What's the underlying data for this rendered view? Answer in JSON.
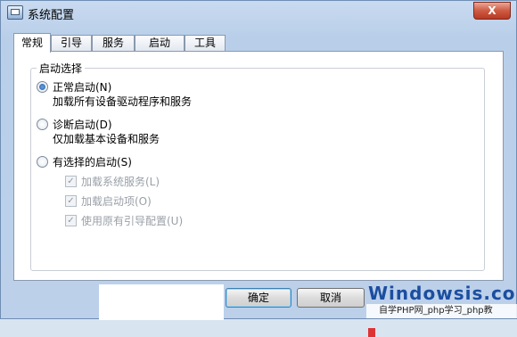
{
  "window": {
    "title": "系统配置",
    "close_label": "X"
  },
  "tabs": [
    {
      "label": "常规"
    },
    {
      "label": "引导"
    },
    {
      "label": "服务"
    },
    {
      "label": "启动"
    },
    {
      "label": "工具"
    }
  ],
  "startup": {
    "group_label": "启动选择",
    "options": [
      {
        "label": "正常启动(N)",
        "desc": "加载所有设备驱动程序和服务",
        "selected": true
      },
      {
        "label": "诊断启动(D)",
        "desc": "仅加载基本设备和服务",
        "selected": false
      },
      {
        "label": "有选择的启动(S)",
        "selected": false
      }
    ],
    "suboptions": [
      {
        "label": "加载系统服务(L)",
        "checked": true,
        "enabled": false
      },
      {
        "label": "加载启动项(O)",
        "checked": true,
        "enabled": false
      },
      {
        "label": "使用原有引导配置(U)",
        "checked": true,
        "enabled": false
      }
    ]
  },
  "buttons": {
    "ok": "确定",
    "cancel": "取消"
  },
  "watermark": {
    "logo": "Windowsis.com",
    "sub": "自学PHP网_php学习_php教"
  },
  "colors": {
    "accent": "#1f5da8",
    "titlebar": "#c9daf0",
    "close": "#cf5a42"
  }
}
